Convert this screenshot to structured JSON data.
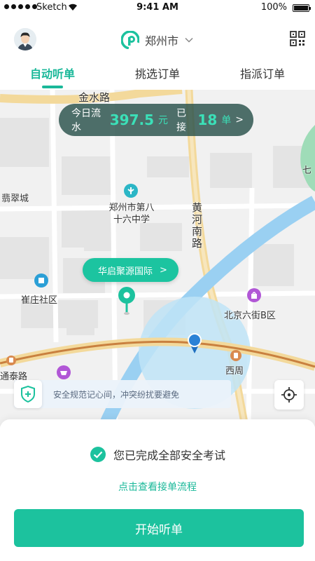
{
  "status_bar": {
    "carrier": "Sketch",
    "time": "9:41 AM",
    "battery": "100%"
  },
  "header": {
    "city": "郑州市",
    "icons": {
      "avatar": "driver-avatar",
      "logo": "brand-logo-icon",
      "dropdown": "chevron-down-icon",
      "scan": "qr-code-icon"
    }
  },
  "tabs": [
    {
      "label": "自动听单",
      "active": true
    },
    {
      "label": "挑选订单",
      "active": false
    },
    {
      "label": "指派订单",
      "active": false
    }
  ],
  "earnings": {
    "prefix": "今日流水",
    "amount": "397.5",
    "unit": "元",
    "middle": "已接",
    "count": "18",
    "count_unit": "单",
    "arrow": ">"
  },
  "map": {
    "labels": {
      "road_top": "金水路",
      "cuicheng": "翡翠城",
      "school": "郑州市第八十六中学",
      "road_huanghe": "黄河南路",
      "cuizhuang": "崔庄社区",
      "beijing": "北京六街B区",
      "tongtai": "通泰路",
      "xizhou": "西周",
      "seven": "七"
    },
    "poi_pill": {
      "label": "华启聚源国际",
      "arrow": ">"
    }
  },
  "safety": {
    "message": "安全规范记心间，冲突纷扰要避免"
  },
  "sheet": {
    "exam_status": "您已完成全部安全考试",
    "flow_link": "点击查看接单流程",
    "start_button": "开始听单"
  },
  "colors": {
    "accent": "#1cc29e",
    "accent_text": "#1ab899",
    "earnings_bg": "#28504b",
    "earnings_highlight": "#3be0b8"
  }
}
